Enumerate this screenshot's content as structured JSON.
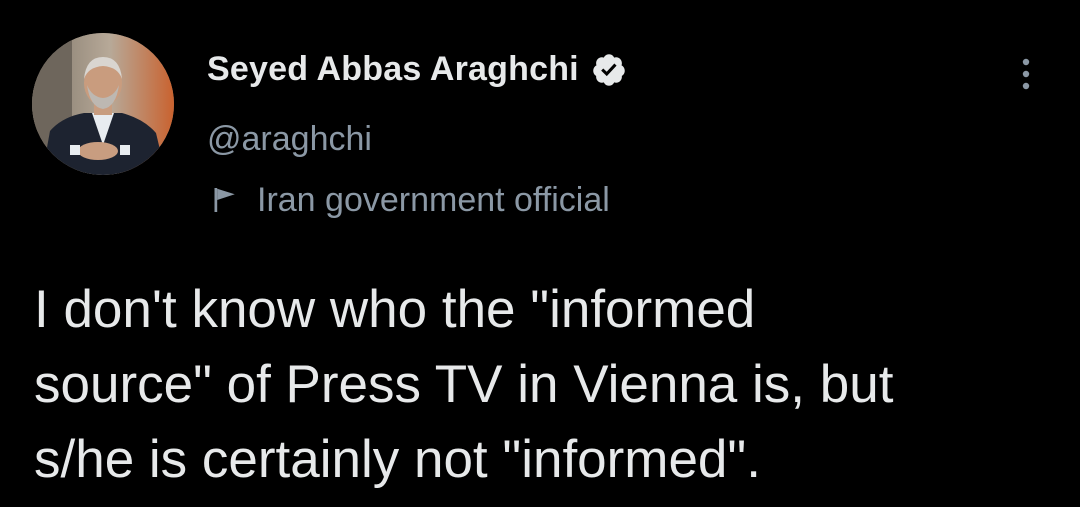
{
  "author": {
    "display_name": "Seyed Abbas Araghchi",
    "handle": "@araghchi",
    "verified": true,
    "label": "Iran government official"
  },
  "tweet": {
    "text": "I don't know who the \"informed\nsource\" of Press TV in Vienna is, but\ns/he is certainly not \"informed\"."
  },
  "icons": {
    "verified": "verified-badge-icon",
    "label": "flag-icon",
    "more": "more-options-icon"
  },
  "colors": {
    "background": "#000000",
    "primary_text": "#e7e9ea",
    "secondary_text": "#8b98a5"
  }
}
